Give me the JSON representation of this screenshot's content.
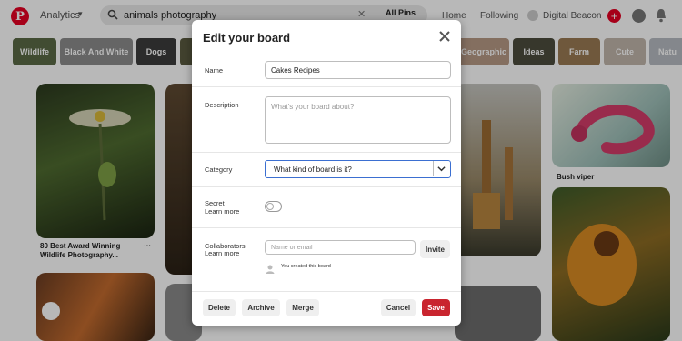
{
  "topbar": {
    "logo_letter": "P",
    "analytics_label": "Analytics",
    "search_value": "animals photography",
    "search_scope": "All Pins",
    "home_label": "Home",
    "following_label": "Following",
    "profile_name": "Digital Beacon"
  },
  "chips": [
    "Wildlife",
    "Black And White",
    "Dogs",
    "",
    "al Geographic",
    "Ideas",
    "Farm",
    "Cute",
    "Natu"
  ],
  "pins": {
    "caption_1": "80 Best Award Winning Wildlife Photography...",
    "caption_2": "Bush viper",
    "more": "···"
  },
  "modal": {
    "title": "Edit your board",
    "name_label": "Name",
    "name_value": "Cakes Recipes",
    "description_label": "Description",
    "description_placeholder": "What's your board about?",
    "category_label": "Category",
    "category_value": "What kind of board is it?",
    "secret_label": "Secret",
    "secret_learn_more": "Learn more",
    "collaborators_label": "Collaborators",
    "collaborators_learn_more": "Learn more",
    "collaborator_placeholder": "Name or email",
    "invite_label": "Invite",
    "created_note": "You created this board",
    "delete_label": "Delete",
    "archive_label": "Archive",
    "merge_label": "Merge",
    "cancel_label": "Cancel",
    "save_label": "Save"
  },
  "colors": {
    "brand_red": "#e60023",
    "save_red": "#c9252f",
    "focus_blue": "#3b6fd1"
  }
}
